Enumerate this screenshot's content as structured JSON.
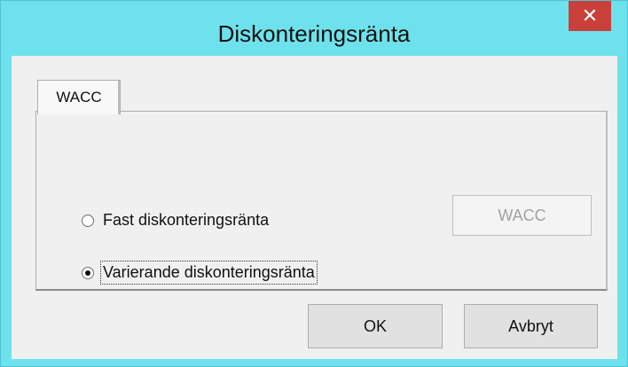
{
  "window": {
    "title": "Diskonteringsränta",
    "close_glyph": "✕"
  },
  "tabs": [
    {
      "label": "WACC",
      "selected": true
    }
  ],
  "options": {
    "fixed_rate_label": "Fast diskonteringsränta",
    "fixed_rate_checked": false,
    "variable_rate_label": "Varierande diskonteringsränta",
    "variable_rate_checked": true
  },
  "buttons": {
    "wacc_label": "WACC",
    "wacc_enabled": false,
    "ok_label": "OK",
    "cancel_label": "Avbryt"
  },
  "colors": {
    "titlebar": "#6ee2ec",
    "close_button": "#c9403a",
    "dialog_background": "#f0f0f0"
  }
}
